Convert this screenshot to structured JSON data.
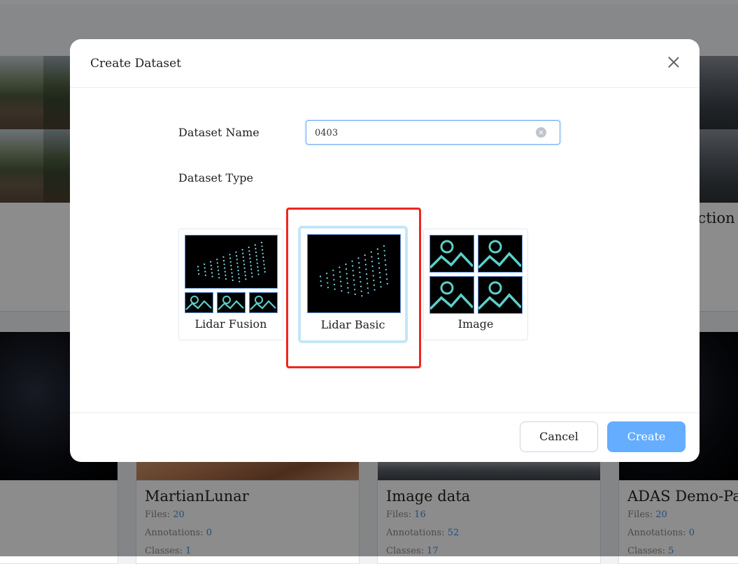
{
  "modal": {
    "title": "Create Dataset",
    "name_label": "Dataset Name",
    "name_value": "0403",
    "type_label": "Dataset Type",
    "types": [
      {
        "label": "Lidar Fusion",
        "selected": false
      },
      {
        "label": "Lidar Basic",
        "selected": true
      },
      {
        "label": "Image",
        "selected": false
      }
    ],
    "cancel_label": "Cancel",
    "create_label": "Create",
    "accent_color": "#64adff",
    "highlight_color": "#f0251f"
  },
  "background": {
    "partial_title": "ection",
    "cards": [
      {
        "title": "MartianLunar",
        "files_label": "Files:",
        "files": "20",
        "annotations_label": "Annotations:",
        "annotations": "0",
        "classes_label": "Classes:",
        "classes": "1"
      },
      {
        "title": "Image data",
        "files_label": "Files:",
        "files": "16",
        "annotations_label": "Annotations:",
        "annotations": "52",
        "classes_label": "Classes:",
        "classes": "17"
      },
      {
        "title": "ADAS Demo-Par",
        "files_label": "Files:",
        "files": "20",
        "annotations_label": "Annotations:",
        "annotations": "0",
        "classes_label": "Classes:",
        "classes": "5"
      }
    ]
  }
}
